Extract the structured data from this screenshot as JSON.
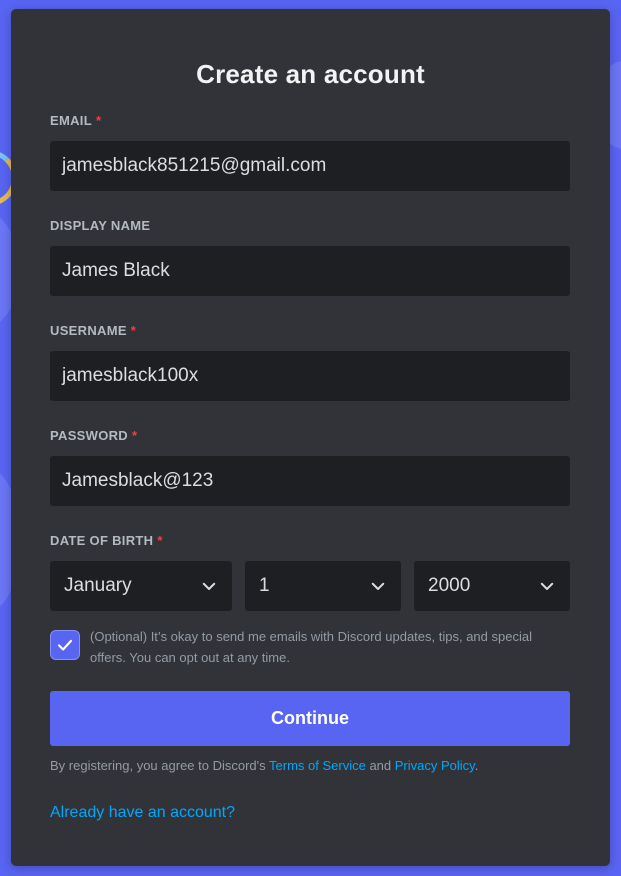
{
  "colors": {
    "background": "#5865f2",
    "card": "#313338",
    "input": "#1e1f22",
    "accent": "#5865f2",
    "link": "#00a8fc",
    "required": "#f23f43"
  },
  "form": {
    "title": "Create an account",
    "email": {
      "label": "EMAIL",
      "required_mark": "*",
      "value": "jamesblack851215@gmail.com"
    },
    "display_name": {
      "label": "DISPLAY NAME",
      "value": "James Black"
    },
    "username": {
      "label": "USERNAME",
      "required_mark": "*",
      "value": "jamesblack100x"
    },
    "password": {
      "label": "PASSWORD",
      "required_mark": "*",
      "value": "Jamesblack@123"
    },
    "dob": {
      "label": "DATE OF BIRTH",
      "required_mark": "*",
      "month": "January",
      "day": "1",
      "year": "2000",
      "icon": "chevron-down-icon"
    },
    "optin": {
      "checked": true,
      "icon": "checkmark-icon",
      "text": "(Optional) It’s okay to send me emails with Discord updates, tips, and special offers. You can opt out at any time."
    },
    "continue_label": "Continue",
    "legal": {
      "prefix": "By registering, you agree to Discord's ",
      "terms": "Terms of Service",
      "and": " and ",
      "privacy": "Privacy Policy",
      "suffix": "."
    },
    "login_link": "Already have an account?"
  }
}
